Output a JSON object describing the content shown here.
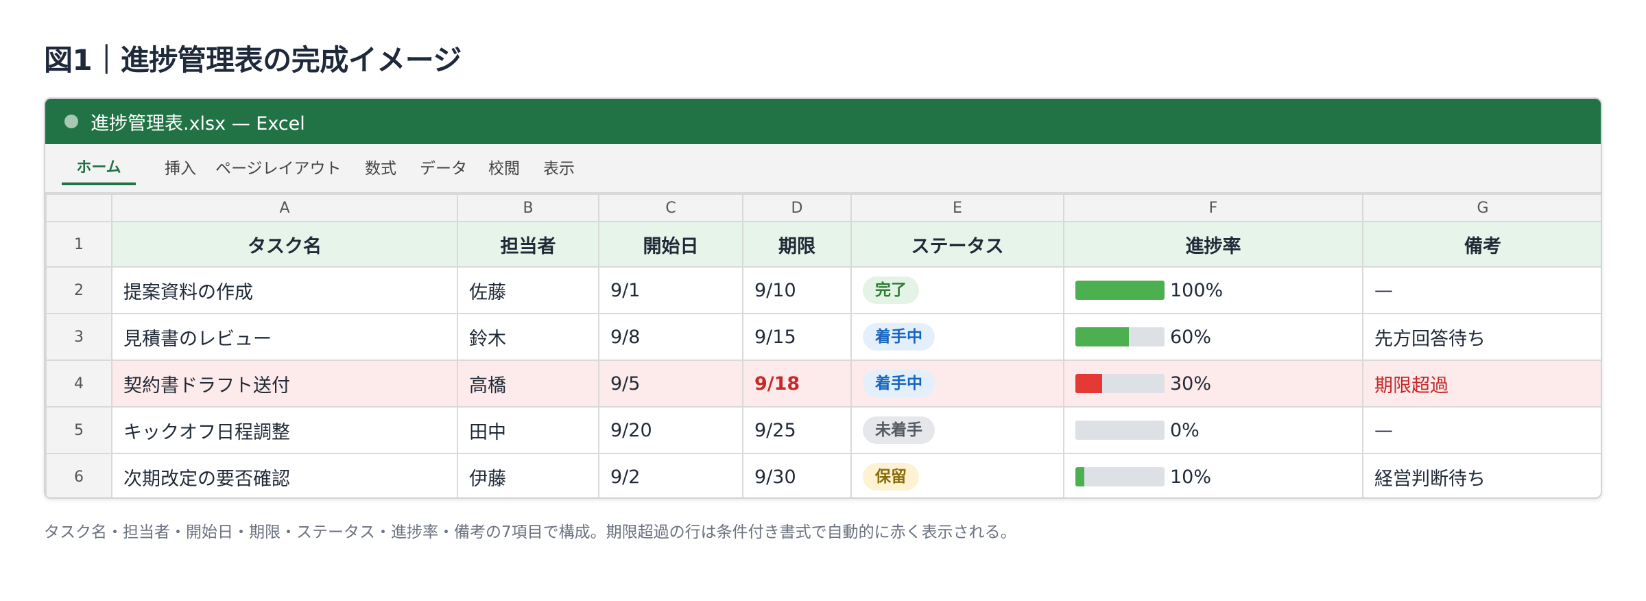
{
  "figure_title": "図1｜進捗管理表の完成イメージ",
  "window": {
    "title": "進捗管理表.xlsx — Excel"
  },
  "ribbon": {
    "tabs": [
      {
        "label": "ホーム",
        "active": true
      },
      {
        "label": "挿入"
      },
      {
        "label": "ページレイアウト"
      },
      {
        "label": "数式"
      },
      {
        "label": "データ"
      },
      {
        "label": "校閲"
      },
      {
        "label": "表示"
      }
    ]
  },
  "sheet": {
    "column_letters": [
      "A",
      "B",
      "C",
      "D",
      "E",
      "F",
      "G"
    ],
    "row_numbers": [
      "1",
      "2",
      "3",
      "4",
      "5",
      "6"
    ],
    "headers": [
      "タスク名",
      "担当者",
      "開始日",
      "期限",
      "ステータス",
      "進捗率",
      "備考"
    ],
    "rows": [
      {
        "task": "提案資料の作成",
        "owner": "佐藤",
        "start": "9/1",
        "due": "9/10",
        "status": "完了",
        "progress_label": "100%",
        "progress": 1.0,
        "note": "—"
      },
      {
        "task": "見積書のレビュー",
        "owner": "鈴木",
        "start": "9/8",
        "due": "9/15",
        "status": "着手中",
        "progress_label": "60%",
        "progress": 0.6,
        "note": "先方回答待ち"
      },
      {
        "task": "契約書ドラフト送付",
        "owner": "高橋",
        "start": "9/5",
        "due": "9/18",
        "status": "着手中",
        "progress_label": "30%",
        "progress": 0.3,
        "note": "期限超過",
        "overdue": true
      },
      {
        "task": "キックオフ日程調整",
        "owner": "田中",
        "start": "9/20",
        "due": "9/25",
        "status": "未着手",
        "progress_label": "0%",
        "progress": 0.0,
        "note": "—"
      },
      {
        "task": "次期改定の要否確認",
        "owner": "伊藤",
        "start": "9/2",
        "due": "9/30",
        "status": "保留",
        "progress_label": "10%",
        "progress": 0.1,
        "note": "経営判断待ち"
      }
    ]
  },
  "caption": "タスク名・担当者・開始日・期限・ステータス・進捗率・備考の7項目で構成。期限超過の行は条件付き書式で自動的に赤く表示される。",
  "colors": {
    "excel_green": "#217346",
    "header_fill": "#e6f4ea",
    "overdue_fill": "#fdeaea",
    "overdue_text": "#c62828",
    "progress_green": "#4caf50",
    "progress_red": "#e53935",
    "status_done_bg": "#e3f3e5",
    "status_done_fg": "#2e7d32",
    "status_active_bg": "#e3f0fb",
    "status_active_fg": "#1565c0",
    "status_todo_bg": "#e5e7ea",
    "status_todo_fg": "#555b63",
    "status_hold_bg": "#fdf3d3",
    "status_hold_fg": "#8a6d0b"
  }
}
